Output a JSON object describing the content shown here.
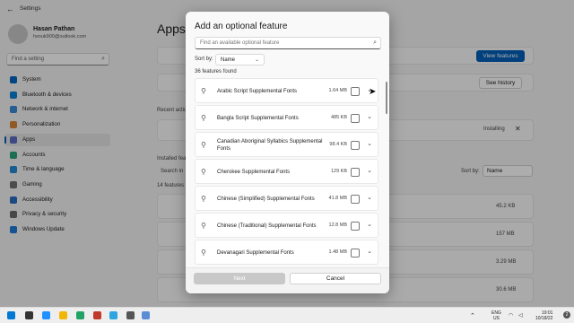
{
  "settings": {
    "title": "Settings",
    "back_glyph": "←",
    "user": {
      "name": "Hasan Pathan",
      "email": "hsnuk900@outlook.com"
    },
    "search_placeholder": "Find a setting",
    "nav": [
      {
        "label": "System",
        "color": "#0067c0"
      },
      {
        "label": "Bluetooth & devices",
        "color": "#0a7fd4"
      },
      {
        "label": "Network & internet",
        "color": "#3b8ad6"
      },
      {
        "label": "Personalization",
        "color": "#d58438"
      },
      {
        "label": "Apps",
        "color": "#5c6ac4",
        "active": true
      },
      {
        "label": "Accounts",
        "color": "#2aa37a"
      },
      {
        "label": "Time & language",
        "color": "#2489d3"
      },
      {
        "label": "Gaming",
        "color": "#707070"
      },
      {
        "label": "Accessibility",
        "color": "#2a6bc1"
      },
      {
        "label": "Privacy & security",
        "color": "#6b6b6b"
      },
      {
        "label": "Windows Update",
        "color": "#1f7ad8"
      }
    ],
    "page_title": "Apps",
    "view_features_label": "View features",
    "see_history_label": "See history",
    "installing_label": "Installing",
    "sort_by_label": "Sort by:",
    "sort_by_value": "Name",
    "recent_fragment": "Recent actio",
    "installed_fragment": "Installed fea",
    "search_fragment": "Search in",
    "features_count_fragment": "14 features f",
    "sizes": [
      "45.2 KB",
      "157 MB",
      "3.29 MB",
      "30.6 MB"
    ]
  },
  "dialog": {
    "title": "Add an optional feature",
    "search_placeholder": "Find an available optional feature",
    "sort_label": "Sort by:",
    "sort_value": "Name",
    "count_text": "36 features found",
    "features": [
      {
        "name": "Arabic Script Supplemental Fonts",
        "size": "1.64 MB"
      },
      {
        "name": "Bangla Script Supplemental Fonts",
        "size": "485 KB"
      },
      {
        "name": "Canadian Aboriginal Syllabics Supplemental Fonts",
        "size": "98.4 KB"
      },
      {
        "name": "Cherokee Supplemental Fonts",
        "size": "129 KB"
      },
      {
        "name": "Chinese (Simplified) Supplemental Fonts",
        "size": "41.8 MB"
      },
      {
        "name": "Chinese (Traditional) Supplemental Fonts",
        "size": "12.8 MB"
      },
      {
        "name": "Devanagari Supplemental Fonts",
        "size": "1.48 MB"
      }
    ],
    "next_label": "Next",
    "cancel_label": "Cancel"
  },
  "taskbar": {
    "lang": "ENG",
    "region": "US",
    "time": "19:01",
    "date": "10/18/22",
    "badge": "2"
  }
}
